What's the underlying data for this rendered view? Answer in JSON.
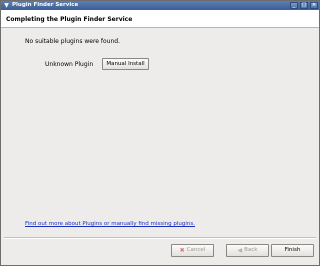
{
  "window": {
    "title": "Plugin Finder Service",
    "menu_icon": "▼",
    "min_glyph": "_",
    "max_glyph": "□",
    "close_glyph": "×"
  },
  "header": {
    "heading": "Completing the Plugin Finder Service"
  },
  "main": {
    "message": "No suitable plugins were found.",
    "plugin_name": "Unknown Plugin",
    "manual_install_label": "Manual Install",
    "help_link": "Find out more about Plugins or manually find missing plugins."
  },
  "footer": {
    "cancel_label": "Cancel",
    "cancel_icon": "✖",
    "back_label": "Back",
    "back_icon": "◀",
    "finish_label": "Finish"
  },
  "colors": {
    "titlebar": "#3b5f95",
    "link": "#1a2fbf",
    "disabled_text": "#9a9893"
  }
}
